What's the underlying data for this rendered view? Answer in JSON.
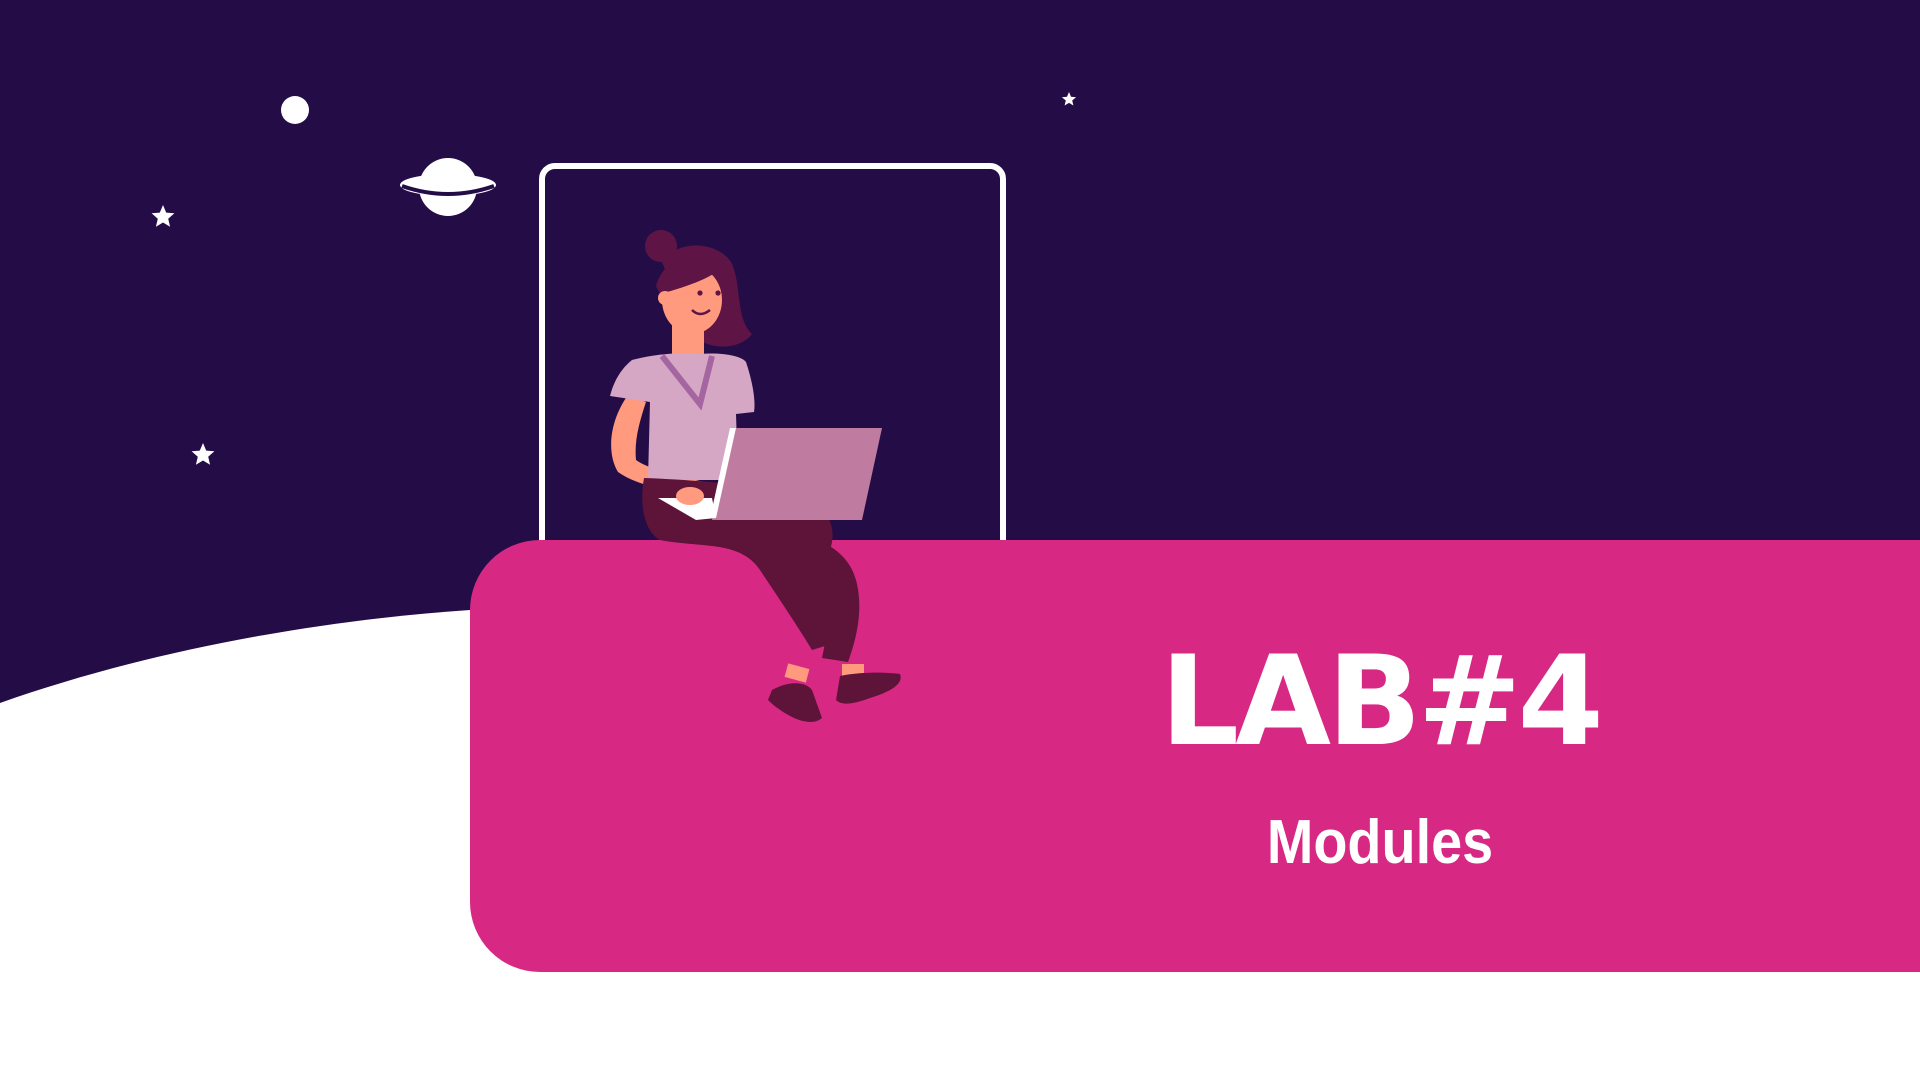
{
  "slide": {
    "title": "LAB#4",
    "subtitle": "Modules"
  },
  "colors": {
    "night_sky": "#240d46",
    "accent_panel": "#d72984",
    "ground": "#ffffff",
    "frame_stroke": "#ffffff",
    "hair": "#5e1545",
    "skin": "#ff9a7e",
    "shirt": "#d5a7c5",
    "laptop": "#c07ba0",
    "pants": "#5e1339"
  },
  "icons": [
    "planet-icon",
    "moon-icon",
    "star-icon"
  ]
}
